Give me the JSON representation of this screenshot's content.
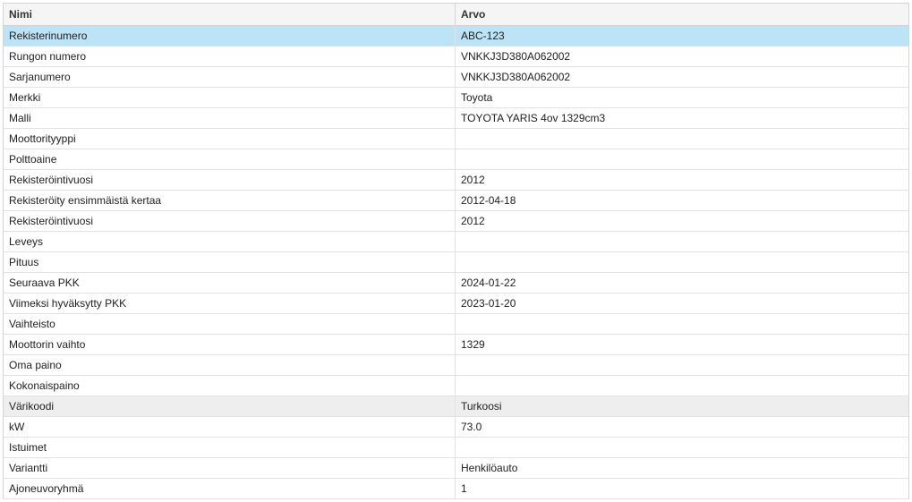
{
  "table": {
    "columns": {
      "name": "Nimi",
      "value": "Arvo"
    },
    "selected_row": 0,
    "hover_row": 18,
    "rows": [
      {
        "name": "Rekisterinumero",
        "value": "ABC-123"
      },
      {
        "name": "Rungon numero",
        "value": "VNKKJ3D380A062002"
      },
      {
        "name": "Sarjanumero",
        "value": "VNKKJ3D380A062002"
      },
      {
        "name": "Merkki",
        "value": "Toyota"
      },
      {
        "name": "Malli",
        "value": "TOYOTA YARIS 4ov 1329cm3"
      },
      {
        "name": "Moottorityyppi",
        "value": ""
      },
      {
        "name": "Polttoaine",
        "value": ""
      },
      {
        "name": "Rekisteröintivuosi",
        "value": "2012"
      },
      {
        "name": "Rekisteröity ensimmäistä kertaa",
        "value": "2012-04-18"
      },
      {
        "name": "Rekisteröintivuosi",
        "value": "2012"
      },
      {
        "name": "Leveys",
        "value": ""
      },
      {
        "name": "Pituus",
        "value": ""
      },
      {
        "name": "Seuraava PKK",
        "value": "2024-01-22"
      },
      {
        "name": "Viimeksi hyväksytty PKK",
        "value": "2023-01-20"
      },
      {
        "name": "Vaihteisto",
        "value": ""
      },
      {
        "name": "Moottorin vaihto",
        "value": "1329"
      },
      {
        "name": "Oma paino",
        "value": ""
      },
      {
        "name": "Kokonaispaino",
        "value": ""
      },
      {
        "name": "Värikoodi",
        "value": "Turkoosi"
      },
      {
        "name": "kW",
        "value": "73.0"
      },
      {
        "name": "Istuimet",
        "value": ""
      },
      {
        "name": "Variantti",
        "value": "Henkilöauto"
      },
      {
        "name": "Ajoneuvoryhmä",
        "value": "1"
      }
    ]
  },
  "colors": {
    "selected_row": "#bde3f7",
    "hover_row": "#eeeeee",
    "header_bg": "#f5f5f5"
  }
}
